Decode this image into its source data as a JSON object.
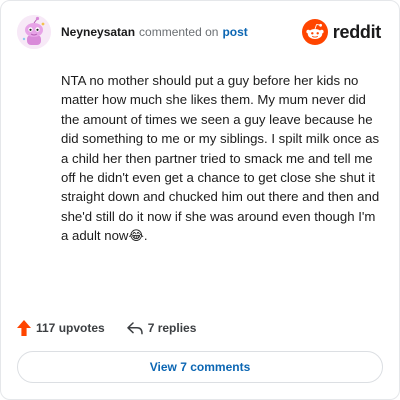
{
  "comment": {
    "username": "Neyneysatan",
    "action": "commented on",
    "target_link": "post",
    "body": "NTA no mother should put a guy before her kids no matter how much she likes them. My mum never did the amount of times we seen a guy leave because he did something to me or my siblings. I spilt milk once as a child her then partner tried to smack me and tell me off he didn't even get a chance to get close she shut it straight down and chucked him out there and then and she'd still do it now if she was around even though I'm a adult now😂."
  },
  "brand": {
    "wordmark": "reddit",
    "icon": "reddit-snoo-icon",
    "color": "#ff4500"
  },
  "stats": {
    "upvotes_label": "117 upvotes",
    "replies_label": "7 replies",
    "upvote_icon": "upvote-arrow-icon",
    "reply_icon": "reply-arrow-icon",
    "upvote_color": "#ff4500"
  },
  "view_comments": {
    "label": "View 7 comments"
  },
  "colors": {
    "link": "#0b66b3",
    "muted_text": "#6b6f73",
    "border": "#e5e7ea"
  }
}
